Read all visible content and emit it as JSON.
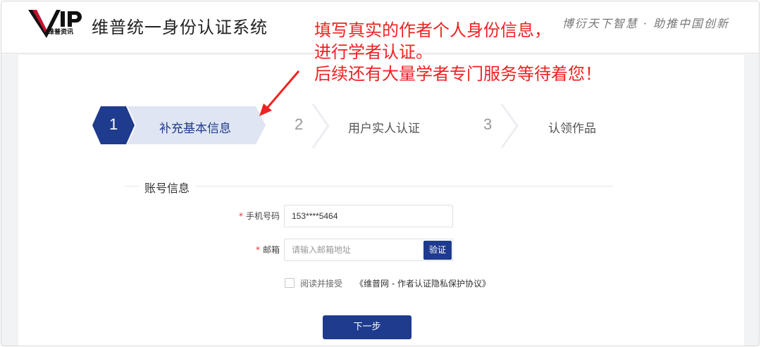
{
  "header": {
    "logo_text": "VIP",
    "logo_subtitle": "维普资讯",
    "system_title": "维普统一身份认证系统",
    "slogan": "博衍天下智慧 · 助推中国创新"
  },
  "annotation": {
    "lines": [
      "填写真实的作者个人身份信息，",
      "进行学者认证。",
      "后续还有大量学者专门服务等待着您！"
    ],
    "color": "#ee2222"
  },
  "steps": [
    {
      "number": "1",
      "label": "补充基本信息",
      "active": true
    },
    {
      "number": "2",
      "label": "用户实人认证",
      "active": false
    },
    {
      "number": "3",
      "label": "认领作品",
      "active": false
    }
  ],
  "form": {
    "section_title": "账号信息",
    "phone": {
      "label": "手机号码",
      "required_mark": "*",
      "value": "153****5464"
    },
    "email": {
      "label": "邮箱",
      "required_mark": "*",
      "placeholder": "请输入邮箱地址",
      "value": ""
    },
    "verify_button": "验证",
    "agreement": {
      "prefix": "阅读并接受",
      "link": "《维普网 - 作者认证隐私保护协议》",
      "checked": false
    },
    "next_button": "下一步"
  },
  "colors": {
    "brand": "#1f3b8e",
    "active_step_bg": "#dfe5f3",
    "annotation_red": "#ee2222"
  },
  "icons": [
    "red-arrow-icon",
    "checkbox-icon"
  ]
}
